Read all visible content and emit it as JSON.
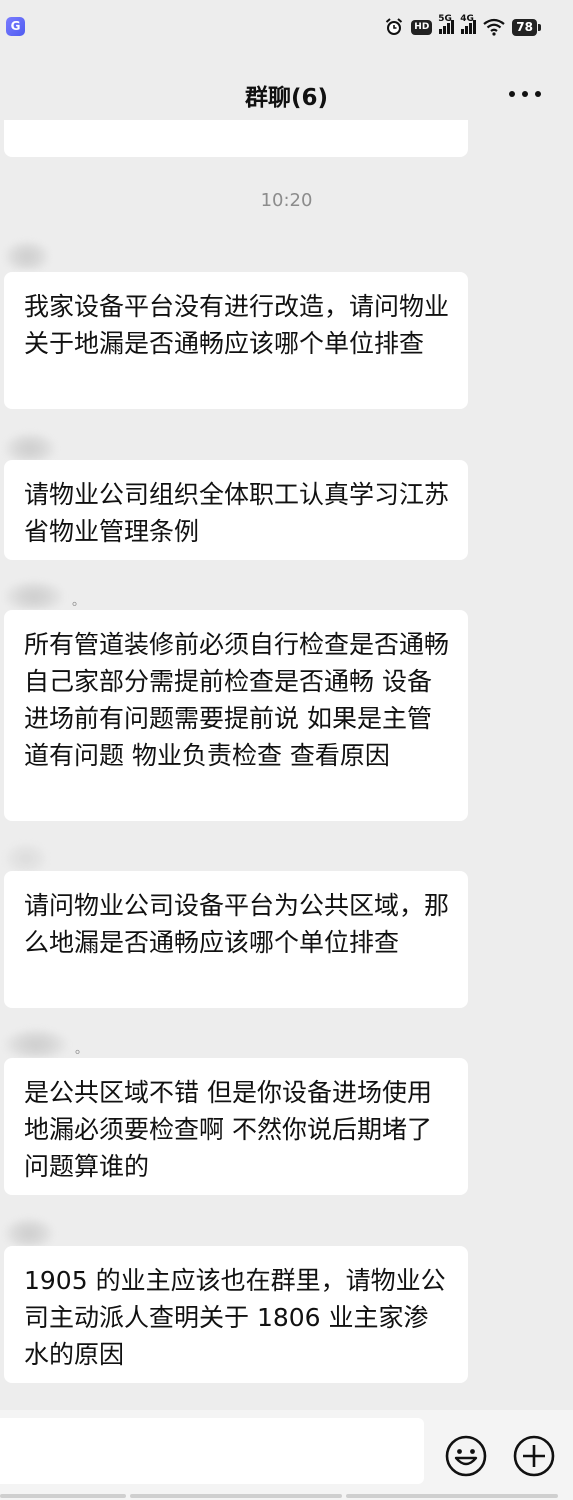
{
  "status_bar": {
    "badge": "G",
    "hd_label": "HD",
    "sim1_network": "5G",
    "sim2_network": "4G",
    "battery": "78"
  },
  "header": {
    "title": "群聊(6)",
    "more_label": "···"
  },
  "chat": {
    "timestamp": "10:20",
    "messages": [
      {
        "text": "我家设备平台没有进行改造，请问物业关于地漏是否通畅应该哪个单位排查"
      },
      {
        "text": "请物业公司组织全体职工认真学习江苏省物业管理条例"
      },
      {
        "sender_suffix": "。",
        "text": "所有管道装修前必须自行检查是否通畅 自己家部分需提前检查是否通畅 设备进场前有问题需要提前说 如果是主管道有问题 物业负责检查 查看原因"
      },
      {
        "text": "请问物业公司设备平台为公共区域，那么地漏是否通畅应该哪个单位排查"
      },
      {
        "sender_suffix": "。",
        "text": "是公共区域不错 但是你设备进场使用地漏必须要检查啊 不然你说后期堵了问题算谁的"
      },
      {
        "text": "1905 的业主应该也在群里，请物业公司主动派人查明关于 1806 业主家渗水的原因"
      }
    ]
  },
  "input_bar": {
    "placeholder": ""
  },
  "colors": {
    "background": "#ededed",
    "bubble": "#ffffff",
    "timestamp": "#8c8c8c"
  }
}
